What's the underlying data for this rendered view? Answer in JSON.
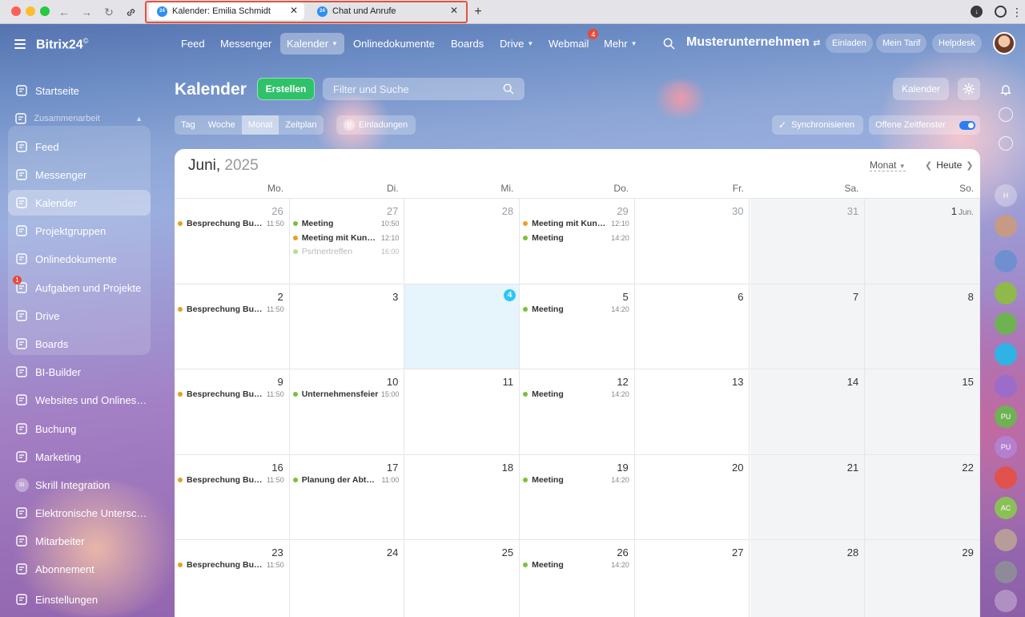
{
  "browser": {
    "tabs": [
      {
        "title": "Kalender: Emilia Schmidt",
        "favicon": "24"
      },
      {
        "title": "Chat und Anrufe",
        "favicon": "24"
      }
    ],
    "new_tab": "+"
  },
  "app": {
    "logo": "Bitrix24",
    "logo_mark": "©"
  },
  "sidebar": {
    "items": [
      {
        "label": "Startseite",
        "icon": "home-icon"
      },
      {
        "label": "Zusammenarbeit",
        "icon": "puzzle-icon"
      },
      {
        "label": "Feed",
        "icon": "feed-icon"
      },
      {
        "label": "Messenger",
        "icon": "chat-icon"
      },
      {
        "label": "Kalender",
        "icon": "calendar-icon"
      },
      {
        "label": "Projektgruppen",
        "icon": "group-icon"
      },
      {
        "label": "Onlinedokumente",
        "icon": "document-icon"
      },
      {
        "label": "Aufgaben und Projekte",
        "icon": "tasks-icon",
        "badge": "1"
      },
      {
        "label": "Drive",
        "icon": "drive-icon"
      },
      {
        "label": "Boards",
        "icon": "board-icon"
      },
      {
        "label": "BI-Builder",
        "icon": "chart-icon"
      },
      {
        "label": "Websites und Onlineshops",
        "icon": "cart-icon"
      },
      {
        "label": "Buchung",
        "icon": "booking-icon"
      },
      {
        "label": "Marketing",
        "icon": "target-icon"
      },
      {
        "label": "Skrill Integration",
        "icon": "si-avatar",
        "avatar": "SI"
      },
      {
        "label": "Elektronische Unterschrift",
        "icon": "signature-icon"
      },
      {
        "label": "Mitarbeiter",
        "icon": "employee-icon"
      },
      {
        "label": "Abonnement",
        "icon": "subscription-icon"
      },
      {
        "label": "Einstellungen",
        "icon": "settings-icon"
      }
    ]
  },
  "topnav": {
    "items": [
      "Feed",
      "Messenger",
      "Kalender",
      "Onlinedokumente",
      "Boards",
      "Drive",
      "Webmail",
      "Mehr"
    ],
    "webmail_badge": "4",
    "company": "Musterunternehmen",
    "invite": "Einladen",
    "tariff": "Mein Tarif",
    "helpdesk": "Helpdesk"
  },
  "toolbar": {
    "title": "Kalender",
    "create": "Erstellen",
    "search_placeholder": "Filter und Suche",
    "calendar_button": "Kalender"
  },
  "views": {
    "items": [
      "Tag",
      "Woche",
      "Monat",
      "Zeitplan"
    ],
    "active": "Monat",
    "invitations_count": "0",
    "invitations_label": "Einladungen",
    "sync": "Synchronisieren",
    "open_slots": "Offene Zeitfenster"
  },
  "calendar": {
    "month": "Juni,",
    "year": "2025",
    "view_selector": "Monat",
    "today_label": "Heute",
    "weekdays": [
      "Mo.",
      "Di.",
      "Mi.",
      "Do.",
      "Fr.",
      "Sa.",
      "So."
    ],
    "weeks": [
      [
        {
          "day": "26",
          "outside": true,
          "events": [
            {
              "title": "Besprechung Buchhaltung",
              "time": "11:50",
              "color": "#e8a020"
            }
          ]
        },
        {
          "day": "27",
          "outside": true,
          "events": [
            {
              "title": "Meeting",
              "time": "10:50",
              "color": "#7bc136"
            },
            {
              "title": "Meeting mit Kunden",
              "time": "12:10",
              "color": "#e8a020"
            },
            {
              "title": "Psrtnertreffen",
              "time": "16:00",
              "color": "#b9de8c",
              "past": true
            }
          ]
        },
        {
          "day": "28",
          "outside": true,
          "events": []
        },
        {
          "day": "29",
          "outside": true,
          "events": [
            {
              "title": "Meeting mit Kunden",
              "time": "12:10",
              "color": "#e8a020"
            },
            {
              "title": "Meeting",
              "time": "14:20",
              "color": "#7bc136"
            }
          ]
        },
        {
          "day": "30",
          "outside": true,
          "events": []
        },
        {
          "day": "31",
          "outside": true,
          "events": []
        },
        {
          "day": "1",
          "month": "Jun.",
          "events": []
        }
      ],
      [
        {
          "day": "2",
          "events": [
            {
              "title": "Besprechung Buchhaltung",
              "time": "11:50",
              "color": "#e8a020"
            }
          ]
        },
        {
          "day": "3",
          "events": []
        },
        {
          "day": "4",
          "today": true,
          "events": []
        },
        {
          "day": "5",
          "events": [
            {
              "title": "Meeting",
              "time": "14:20",
              "color": "#7bc136"
            }
          ]
        },
        {
          "day": "6",
          "events": []
        },
        {
          "day": "7",
          "events": []
        },
        {
          "day": "8",
          "events": []
        }
      ],
      [
        {
          "day": "9",
          "events": [
            {
              "title": "Besprechung Buchhaltung",
              "time": "11:50",
              "color": "#e8a020"
            }
          ]
        },
        {
          "day": "10",
          "events": [
            {
              "title": "Unternehmensfeier",
              "time": "15:00",
              "color": "#7bc136"
            }
          ]
        },
        {
          "day": "11",
          "events": []
        },
        {
          "day": "12",
          "events": [
            {
              "title": "Meeting",
              "time": "14:20",
              "color": "#7bc136"
            }
          ]
        },
        {
          "day": "13",
          "events": []
        },
        {
          "day": "14",
          "events": []
        },
        {
          "day": "15",
          "events": []
        }
      ],
      [
        {
          "day": "16",
          "events": [
            {
              "title": "Besprechung Buchhaltung",
              "time": "11:50",
              "color": "#e8a020"
            }
          ]
        },
        {
          "day": "17",
          "events": [
            {
              "title": "Planung der Abteilung",
              "time": "11:00",
              "color": "#7bc136"
            }
          ]
        },
        {
          "day": "18",
          "events": []
        },
        {
          "day": "19",
          "events": [
            {
              "title": "Meeting",
              "time": "14:20",
              "color": "#7bc136"
            }
          ]
        },
        {
          "day": "20",
          "events": []
        },
        {
          "day": "21",
          "events": []
        },
        {
          "day": "22",
          "events": []
        }
      ],
      [
        {
          "day": "23",
          "events": [
            {
              "title": "Besprechung Buchhaltung",
              "time": "11:50",
              "color": "#e8a020"
            }
          ]
        },
        {
          "day": "24",
          "events": []
        },
        {
          "day": "25",
          "events": []
        },
        {
          "day": "26",
          "events": [
            {
              "title": "Meeting",
              "time": "14:20",
              "color": "#7bc136"
            }
          ]
        },
        {
          "day": "27",
          "events": []
        },
        {
          "day": "28",
          "events": []
        },
        {
          "day": "29",
          "events": []
        }
      ]
    ]
  },
  "rightbar": {
    "avatars": [
      "H",
      "PU",
      "PU",
      "AC"
    ]
  }
}
